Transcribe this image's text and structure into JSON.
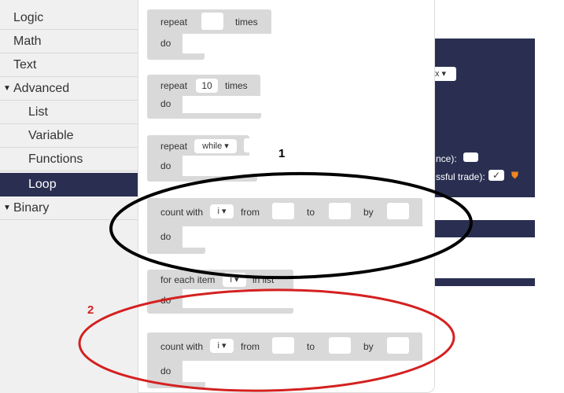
{
  "sidebar": {
    "categories": [
      {
        "label": "Logic"
      },
      {
        "label": "Math"
      },
      {
        "label": "Text"
      },
      {
        "label": "Advanced",
        "expanded": true
      },
      {
        "label": "List"
      },
      {
        "label": "Variable"
      },
      {
        "label": "Functions"
      },
      {
        "label": "Loop",
        "selected": true
      },
      {
        "label": "Binary",
        "expanded": true
      }
    ],
    "expanded_glyph": "▼"
  },
  "workspace_bg": {
    "dropdown_suffix": "x ▾",
    "text_line1": "nce):",
    "text_line2": "ssful trade):",
    "check_glyph": "✓",
    "warn_glyph": "⛊"
  },
  "flyout": {
    "blocks": [
      {
        "kind": "repeat",
        "repeat": "repeat",
        "times": "times",
        "do": "do"
      },
      {
        "kind": "repeat-number",
        "repeat": "repeat",
        "count": "10",
        "times": "times",
        "do": "do"
      },
      {
        "kind": "repeat-while",
        "repeat": "repeat",
        "mode": "while ▾",
        "do": "do"
      },
      {
        "kind": "count-with",
        "count_with": "count with",
        "var": "i ▾",
        "from": "from",
        "to": "to",
        "by": "by",
        "do": "do"
      },
      {
        "kind": "for-each",
        "for_each": "for each item",
        "var": "i ▾",
        "in_list": "in list",
        "do": "do"
      },
      {
        "kind": "count-with",
        "count_with": "count with",
        "var": "i ▾",
        "from": "from",
        "to": "to",
        "by": "by",
        "do": "do"
      }
    ]
  },
  "annotations": [
    {
      "label": "1",
      "color": "#000000"
    },
    {
      "label": "2",
      "color": "#d42020"
    }
  ],
  "colors": {
    "sidebar_bg": "#f0f0f0",
    "selected_bg": "#2a2f52",
    "block_bg": "#d9d9d9",
    "workspace_panel": "#2a2f52",
    "warning": "#f0861f"
  }
}
